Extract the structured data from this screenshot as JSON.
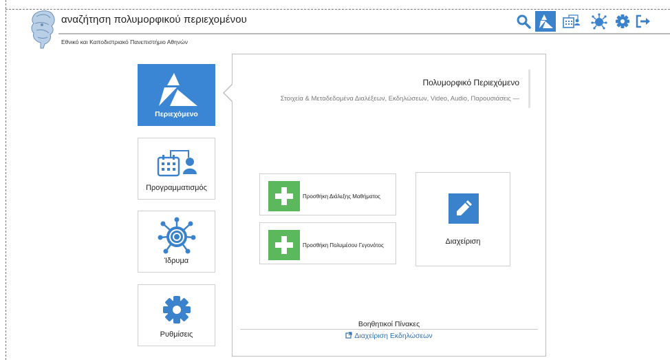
{
  "header": {
    "title": "αναζήτηση πολυμορφικού περιεχομένου",
    "organization": "Εθνικό και Καποδιστριακό Πανεπιστήμιο Αθηνών",
    "toolbar": [
      {
        "icon": "search-icon",
        "active": false
      },
      {
        "icon": "content-triangles-icon",
        "active": true
      },
      {
        "icon": "scheduling-icon",
        "active": false
      },
      {
        "icon": "institution-icon",
        "active": false
      },
      {
        "icon": "gear-icon",
        "active": false
      },
      {
        "icon": "logout-icon",
        "active": false
      }
    ]
  },
  "nav": {
    "tiles": [
      {
        "label": "Περιεχόμενο",
        "icon": "content-triangles-icon",
        "active": true
      },
      {
        "label": "Προγραμματισμός",
        "icon": "calendar-user-icon",
        "active": false
      },
      {
        "label": "Ίδρυμα",
        "icon": "institution-icon",
        "active": false
      },
      {
        "label": "Ρυθμίσεις",
        "icon": "gear-icon",
        "active": false
      }
    ]
  },
  "panel": {
    "title": "Πολυμορφικό Περιεχόμενο",
    "subtitle": "Στοιχεία & Μεταδεδομένα Διαλέξεων, Εκδηλώσεων, Video, Audio, Παρουσιάσεις —",
    "actions": [
      {
        "label": "Προσθήκη Διάλεξης Μαθήματος",
        "icon": "plus-icon"
      },
      {
        "label": "Προσθήκη Πολυμέσου Γεγονότος",
        "icon": "plus-icon"
      }
    ],
    "manage": {
      "label": "Διαχείριση",
      "icon": "edit-icon"
    },
    "aux": {
      "title": "Βοηθητικοί Πίνακες",
      "link": "Διαχείριση Εκδηλώσεων",
      "link_icon": "external-link-icon"
    }
  },
  "colors": {
    "accent": "#3b82cc",
    "green": "#5cb85c",
    "link": "#2f6fb8"
  }
}
